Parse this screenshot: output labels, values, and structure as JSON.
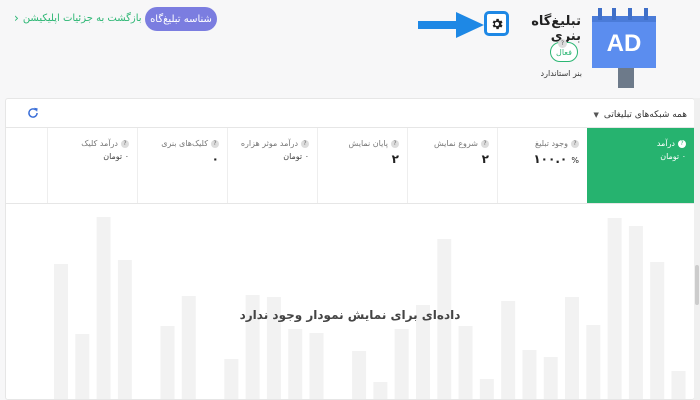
{
  "header": {
    "back_link": "بازگشت به جزئیات اپلیکیشن",
    "id_button": "شناسه تبلیغ‌گاه",
    "title": "تبلیغ‌گاه بنری",
    "status": "فعال",
    "subtitle": "بنر استاندارد",
    "ad_label": "AD"
  },
  "filters": {
    "network_select": "همه شبکه‌های تبلیغاتی"
  },
  "stats": [
    {
      "label": "درآمد",
      "value": "۰",
      "unit": "تومان",
      "active": true
    },
    {
      "label": "وجود تبلیغ",
      "value": "۱۰۰.۰",
      "unit": "%",
      "active": false
    },
    {
      "label": "شروع نمایش",
      "value": "۲",
      "unit": "",
      "active": false
    },
    {
      "label": "پایان نمایش",
      "value": "۲",
      "unit": "",
      "active": false
    },
    {
      "label": "درآمد موثر هزاره",
      "value": "۰",
      "unit": "تومان",
      "active": false
    },
    {
      "label": "کلیک‌های بنری",
      "value": "۰",
      "unit": "",
      "active": false
    },
    {
      "label": "درآمد کلیک",
      "value": "۰",
      "unit": "تومان",
      "active": false
    }
  ],
  "chart": {
    "empty_message": "داده‌ای برای نمایش نمودار وجود ندارد"
  },
  "colors": {
    "accent_green": "#26b36f",
    "button_purple": "#7b7de0",
    "highlight_blue": "#1e88e5",
    "ad_icon_blue": "#5b8def"
  }
}
